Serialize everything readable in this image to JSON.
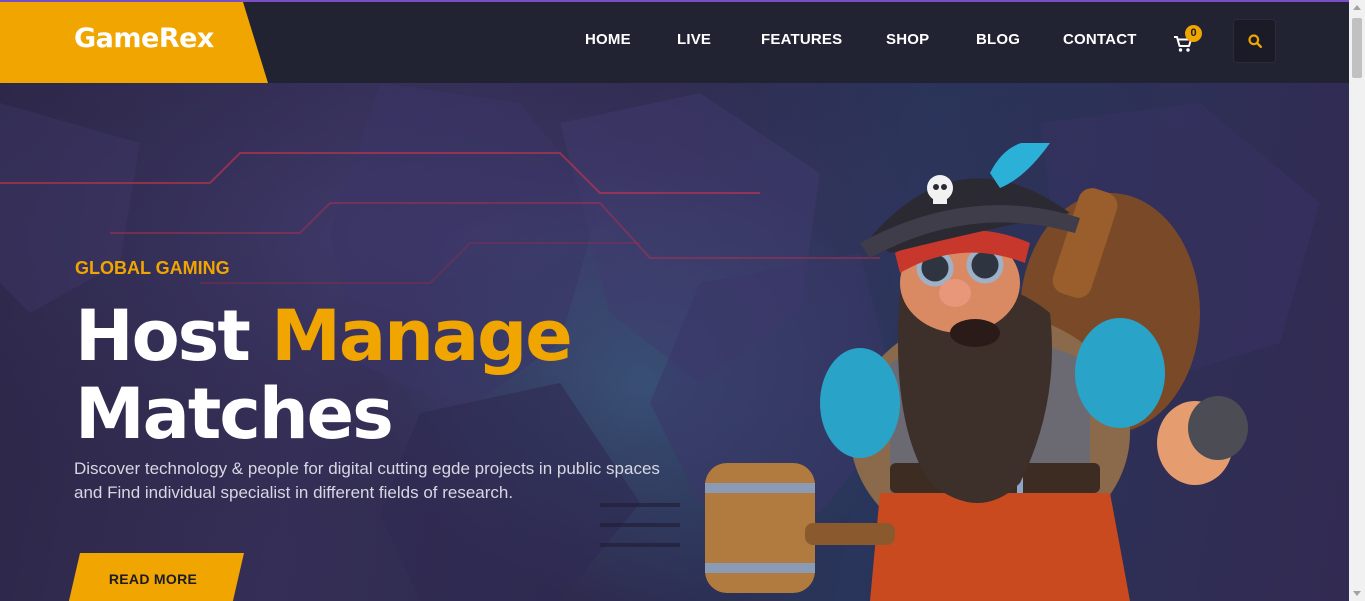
{
  "brand": {
    "name": "GameRex"
  },
  "nav": {
    "items": [
      {
        "label": "HOME"
      },
      {
        "label": "LIVE"
      },
      {
        "label": "FEATURES"
      },
      {
        "label": "SHOP"
      },
      {
        "label": "BLOG"
      },
      {
        "label": "CONTACT"
      }
    ],
    "cart_count": "0",
    "cart_icon": "shopping-cart-icon",
    "search_icon": "search-icon"
  },
  "hero": {
    "eyebrow": "GLOBAL GAMING",
    "headline_part1": "Host",
    "headline_accent": "Manage",
    "headline_part2": "Matches",
    "description": "Discover technology & people for digital cutting egde projects in public spaces and Find individual specialist in different fields of research.",
    "cta_label": "READ MORE"
  },
  "colors": {
    "accent": "#f0a500",
    "nav_bg": "#222332",
    "text_light": "#ffffff"
  }
}
